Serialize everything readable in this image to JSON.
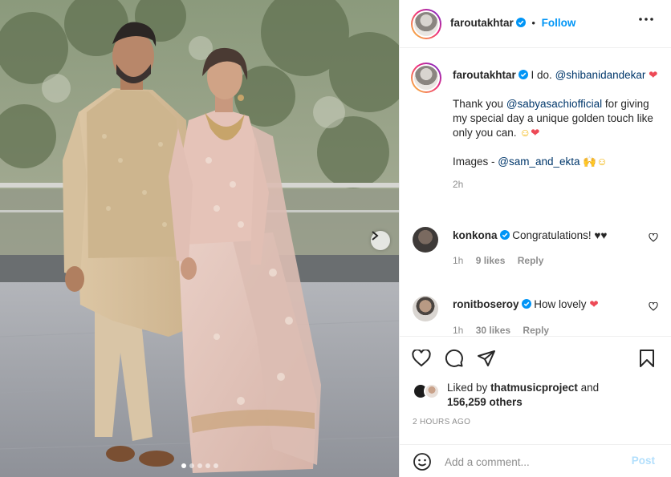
{
  "post": {
    "author": "faroutakhtar",
    "follow_label": "Follow",
    "more_icon": "more-options-icon",
    "verified_color": "#0095f6",
    "carousel": {
      "slide_count": 5,
      "active_index": 0,
      "next_icon": "chevron-right-icon"
    }
  },
  "caption": {
    "username": "faroutakhtar",
    "text1": "I do.",
    "mention1": "@shibanidandekar",
    "line2_pre": "Thank you",
    "mention2": "@sabyasachiofficial",
    "line2_post": "for giving my special day a unique golden touch like only you can.",
    "line3_pre": "Images -",
    "mention3": "@sam_and_ekta",
    "time": "2h"
  },
  "comments": [
    {
      "username": "konkona",
      "text": "Congratulations! ♥♥",
      "time": "1h",
      "likes": "9 likes",
      "reply": "Reply"
    },
    {
      "username": "ronitboseroy",
      "text": "How lovely",
      "time": "1h",
      "likes": "30 likes",
      "reply": "Reply"
    }
  ],
  "actions": {
    "liked_by_prefix": "Liked by",
    "liked_by_user": "thatmusicproject",
    "liked_by_and": "and",
    "others": "156,259 others",
    "timestamp": "2 HOURS AGO"
  },
  "composer": {
    "placeholder": "Add a comment...",
    "post_label": "Post",
    "emoji_icon": "emoji-icon"
  },
  "colors": {
    "accent": "#0095f6",
    "heart": "#ed4956",
    "post_disabled": "#b2dffc"
  }
}
